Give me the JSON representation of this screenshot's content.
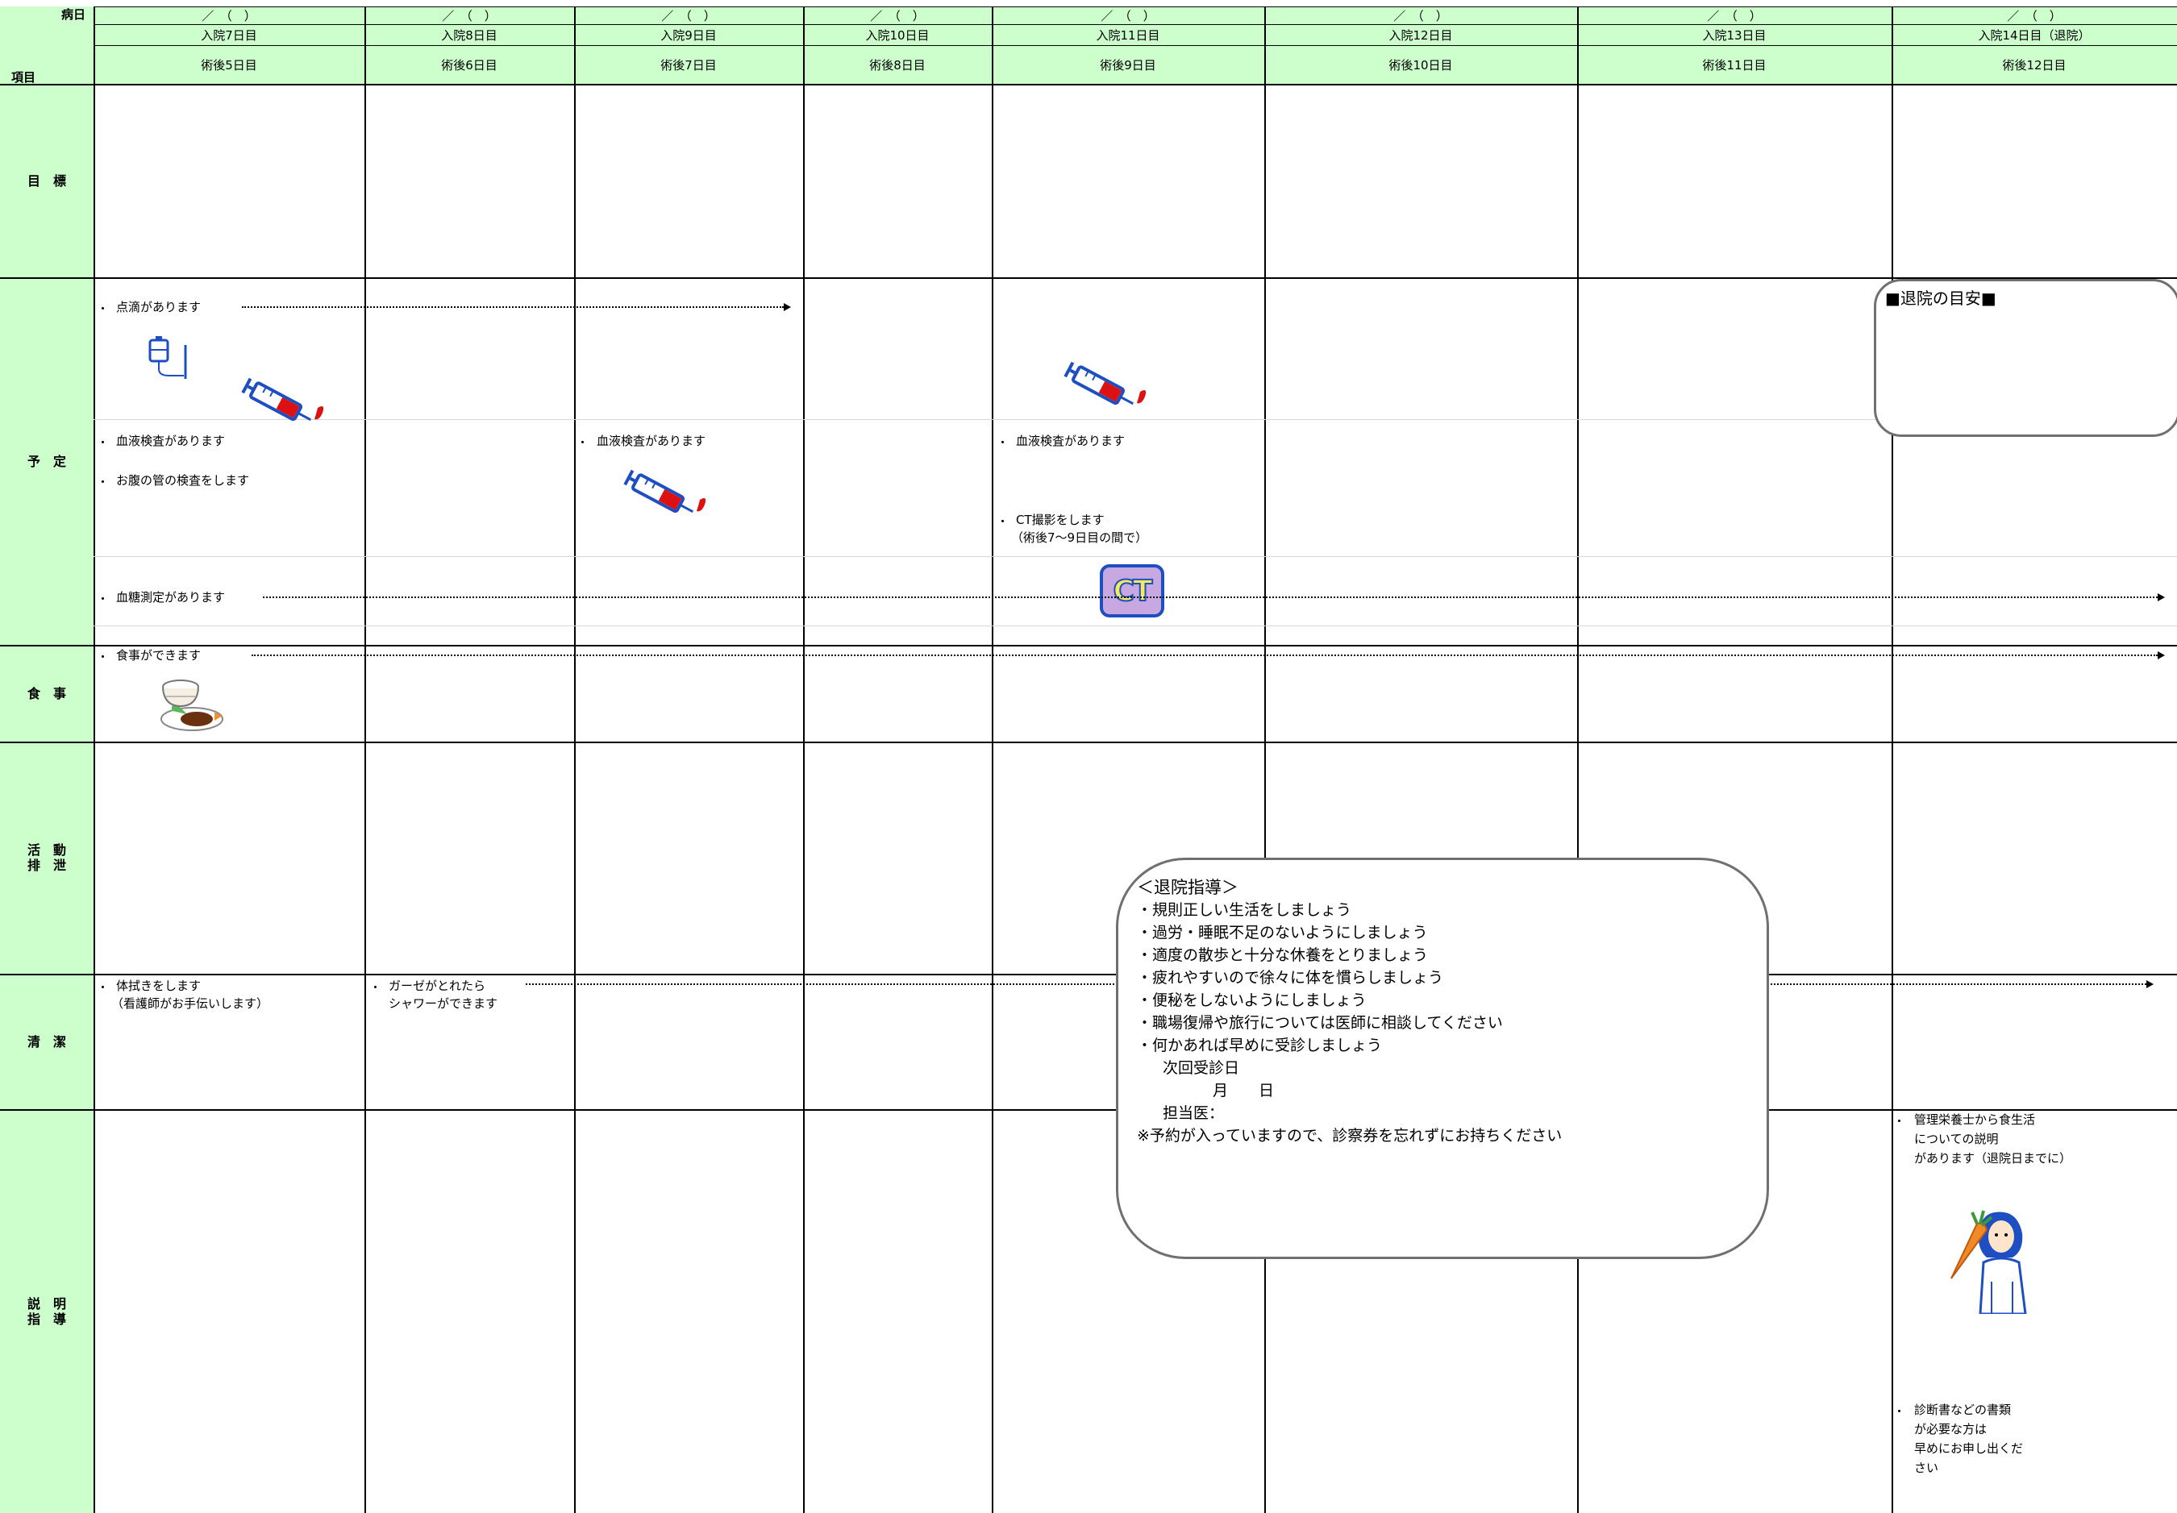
{
  "header": {
    "corner_top": "病日",
    "corner_bottom": "項目",
    "date_placeholder": "／　（　）",
    "columns": [
      {
        "day": "入院7日目",
        "post": "術後5日目"
      },
      {
        "day": "入院8日目",
        "post": "術後6日目"
      },
      {
        "day": "入院9日目",
        "post": "術後7日目"
      },
      {
        "day": "入院10日目",
        "post": "術後8日目"
      },
      {
        "day": "入院11日目",
        "post": "術後9日目"
      },
      {
        "day": "入院12日目",
        "post": "術後10日目"
      },
      {
        "day": "入院13日目",
        "post": "術後11日目"
      },
      {
        "day": "入院14日目（退院）",
        "post": "術後12日目"
      }
    ]
  },
  "rows": {
    "goal": {
      "line1": "目　標"
    },
    "schedule": {
      "line1": "予　定"
    },
    "meal": {
      "line1": "食　事"
    },
    "activity": {
      "line1": "活　動",
      "line2": "排　泄"
    },
    "hygiene": {
      "line1": "清　潔"
    },
    "explanation": {
      "line1": "説　明",
      "line2": "指　導"
    }
  },
  "schedule": {
    "drip": "点滴があります",
    "blood_test_1": "血液検査があります",
    "tube_test": "お腹の管の検査をします",
    "blood_sugar": "血糖測定があります",
    "blood_test_3": "血液検査があります",
    "blood_test_5": "血液検査があります",
    "ct_line1": "CT撮影をします",
    "ct_line2": "（術後7～9日目の間で）",
    "ct_icon_text": "CT"
  },
  "discharge_box": {
    "title": "■退院の目安■"
  },
  "meal": {
    "text": "食事ができます"
  },
  "hygiene": {
    "wipe_line1": "体拭きをします",
    "wipe_line2": "（看護師がお手伝いします）",
    "shower_line1": "ガーゼがとれたら",
    "shower_line2": "シャワーができます"
  },
  "guidance_box": {
    "title": "＜退院指導＞",
    "items": [
      "・規則正しい生活をしましょう",
      "・過労・睡眠不足のないようにしましょう",
      "・適度の散歩と十分な休養をとりましょう",
      "・疲れやすいので徐々に体を慣らしましょう",
      "・便秘をしないようにしましょう",
      "・職場復帰や旅行については医師に相談してください",
      "・何かあれば早めに受診しましょう"
    ],
    "next_visit": "次回受診日",
    "month_day": "月　　日",
    "doctor": "担当医：",
    "note": "※予約が入っていますので、診察券を忘れずにお持ちください"
  },
  "explanation": {
    "nutrition_line1": "管理栄養士から食生活",
    "nutrition_line2": "についての説明",
    "nutrition_line3": "があります（退院日までに）",
    "docs_line1": "診断書などの書類",
    "docs_line2": "が必要な方は",
    "docs_line3": "早めにお申し出くだ",
    "docs_line4": "さい"
  },
  "colors": {
    "header_bg": "#ccffcc",
    "grid": "#000000",
    "syringe_red": "#dd1111",
    "icon_blue": "#1e4fc2",
    "ct_purple": "#c8a8e0",
    "ct_yellow": "#f5ea5a"
  }
}
